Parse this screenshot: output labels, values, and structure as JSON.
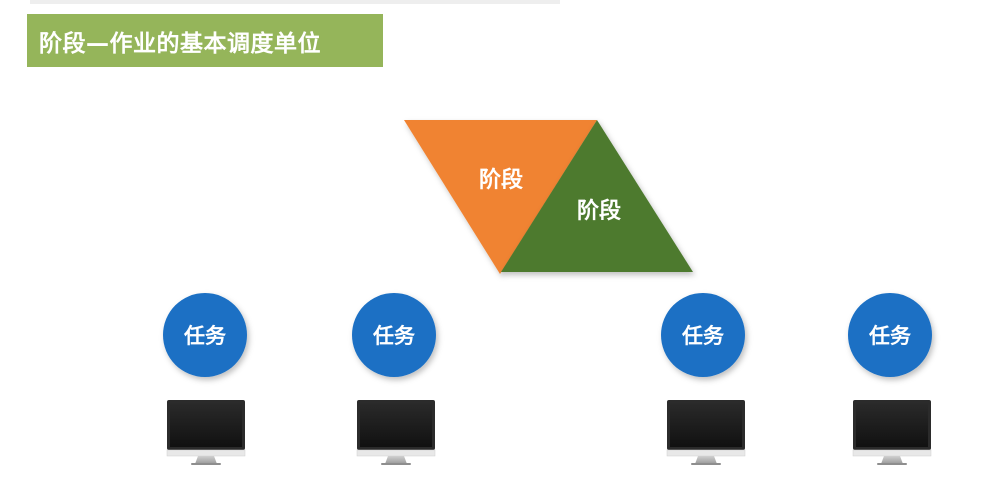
{
  "title": "阶段—作业的基本调度单位",
  "stages": [
    {
      "label": "阶段",
      "color": "#f08331"
    },
    {
      "label": "阶段",
      "color": "#4d7a2e"
    }
  ],
  "tasks": [
    {
      "label": "任务"
    },
    {
      "label": "任务"
    },
    {
      "label": "任务"
    },
    {
      "label": "任务"
    }
  ],
  "colors": {
    "banner": "#95b55a",
    "task_circle": "#1a6fc4",
    "monitor_screen": "#1b1b1b"
  },
  "icons": [
    "computer-monitor-icon"
  ]
}
